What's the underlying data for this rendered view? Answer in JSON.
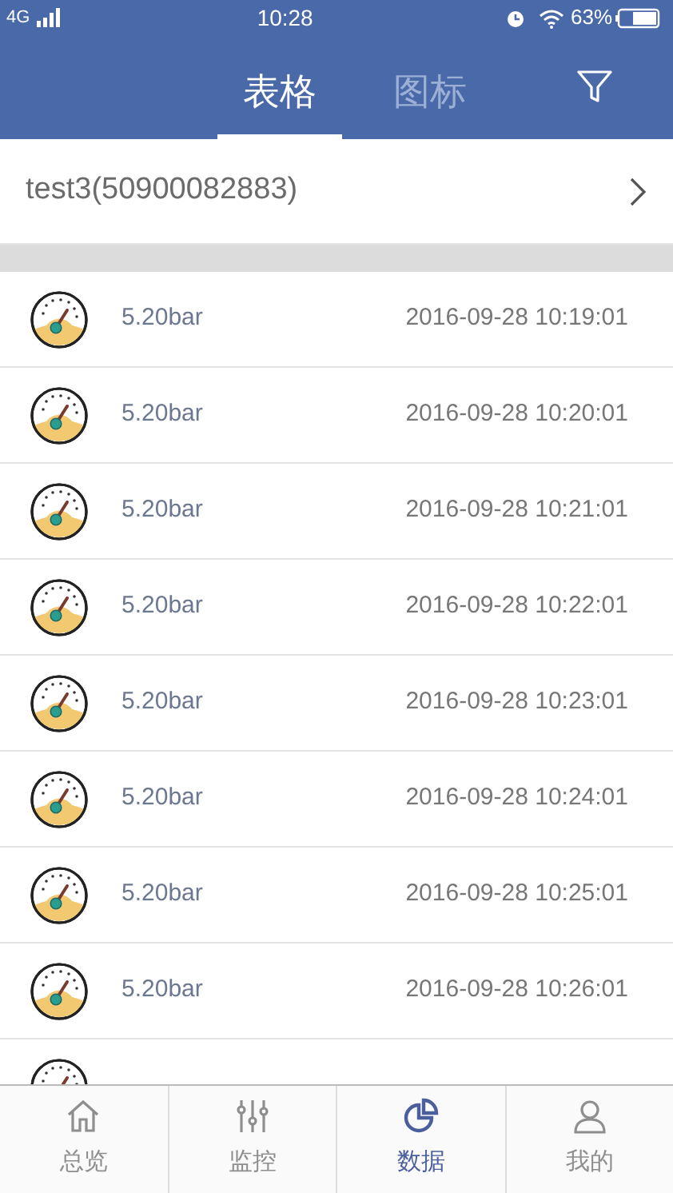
{
  "status_bar": {
    "carrier": "4G",
    "time": "10:28",
    "battery": "63%"
  },
  "header": {
    "tabs": [
      {
        "label": "表格",
        "selected": true
      },
      {
        "label": "图标",
        "selected": false
      }
    ]
  },
  "device": {
    "name": "test3(50900082883)"
  },
  "records": [
    {
      "value": "5.20bar",
      "time": "2016-09-28 10:19:01"
    },
    {
      "value": "5.20bar",
      "time": "2016-09-28 10:20:01"
    },
    {
      "value": "5.20bar",
      "time": "2016-09-28 10:21:01"
    },
    {
      "value": "5.20bar",
      "time": "2016-09-28 10:22:01"
    },
    {
      "value": "5.20bar",
      "time": "2016-09-28 10:23:01"
    },
    {
      "value": "5.20bar",
      "time": "2016-09-28 10:24:01"
    },
    {
      "value": "5.20bar",
      "time": "2016-09-28 10:25:01"
    },
    {
      "value": "5.20bar",
      "time": "2016-09-28 10:26:01"
    }
  ],
  "tab_bar": [
    {
      "label": "总览",
      "kind": "home",
      "selected": false
    },
    {
      "label": "监控",
      "kind": "sliders",
      "selected": false
    },
    {
      "label": "数据",
      "kind": "pie",
      "selected": true
    },
    {
      "label": "我的",
      "kind": "user",
      "selected": false
    }
  ]
}
